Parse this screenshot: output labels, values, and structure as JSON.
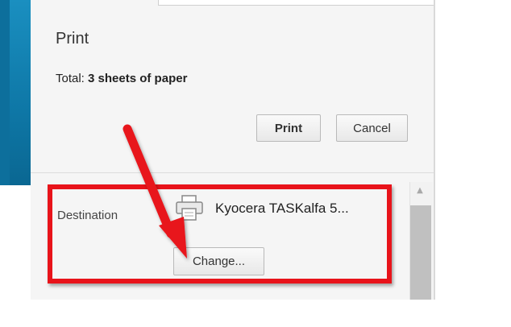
{
  "dialog": {
    "title": "Print",
    "total_label": "Total:",
    "total_value": "3 sheets of paper",
    "print_button": "Print",
    "cancel_button": "Cancel"
  },
  "destination": {
    "label": "Destination",
    "printer_name": "Kyocera TASKalfa 5...",
    "change_button": "Change...",
    "printer_icon": "printer-icon"
  },
  "annotation": {
    "highlight_color": "#e8131a",
    "arrow_color": "#e8131a"
  },
  "colors": {
    "panel_bg": "#f5f5f5",
    "side_accent": "#0e77a6"
  }
}
